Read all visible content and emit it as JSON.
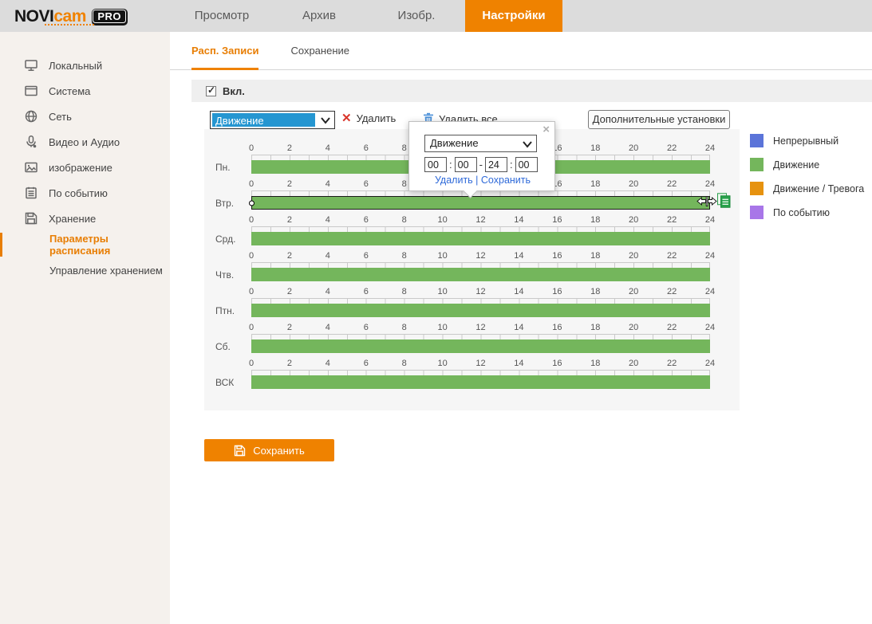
{
  "accent_color": "#ef8200",
  "brand": {
    "novi": "NOVI",
    "cam": "cam",
    "pro": "PRO"
  },
  "topnav": {
    "items": [
      {
        "label": "Просмотр",
        "active": false
      },
      {
        "label": "Архив",
        "active": false
      },
      {
        "label": "Изобр.",
        "active": false
      },
      {
        "label": "Настройки",
        "active": true
      }
    ]
  },
  "sidebar": {
    "items": [
      {
        "label": "Локальный",
        "icon": "monitor-icon"
      },
      {
        "label": "Система",
        "icon": "system-window-icon"
      },
      {
        "label": "Сеть",
        "icon": "network-globe-icon"
      },
      {
        "label": "Видео и Аудио",
        "icon": "microphone-icon"
      },
      {
        "label": "изображение",
        "icon": "image-icon"
      },
      {
        "label": "По событию",
        "icon": "event-list-icon"
      },
      {
        "label": "Хранение",
        "icon": "storage-floppy-icon"
      }
    ],
    "subitems": [
      {
        "label": "Параметры расписания",
        "active": true
      },
      {
        "label": "Управление хранением",
        "active": false
      }
    ]
  },
  "content_tabs": [
    {
      "label": "Расп. Записи",
      "active": true
    },
    {
      "label": "Сохранение",
      "active": false
    }
  ],
  "enable": {
    "label": "Вкл.",
    "checked": true,
    "check_glyph": "✓"
  },
  "toolbar": {
    "type_select_value": "Движение",
    "delete_label": "Удалить",
    "delete_icon_glyph": "✕",
    "delete_all_label": "Удалить все",
    "advanced_label": "Дополнительные установки"
  },
  "popup": {
    "close_label": "×",
    "type_select_value": "Движение",
    "start_hour": "00",
    "start_min": "00",
    "end_hour": "24",
    "end_min": "00",
    "colon": ":",
    "dash": "-",
    "delete_label": "Удалить",
    "separator": " | ",
    "save_label": "Сохранить"
  },
  "schedule": {
    "hours": [
      "0",
      "2",
      "4",
      "6",
      "8",
      "10",
      "12",
      "14",
      "16",
      "18",
      "20",
      "22",
      "24"
    ],
    "bar_color": "#74b65c",
    "days": [
      {
        "label": "Пн.",
        "selected": false,
        "interval": {
          "start": "00:00",
          "end": "24:00",
          "type": "Движение"
        }
      },
      {
        "label": "Втр.",
        "selected": true,
        "interval": {
          "start": "00:00",
          "end": "24:00",
          "type": "Движение"
        }
      },
      {
        "label": "Срд.",
        "selected": false,
        "interval": {
          "start": "00:00",
          "end": "24:00",
          "type": "Движение"
        }
      },
      {
        "label": "Чтв.",
        "selected": false,
        "interval": {
          "start": "00:00",
          "end": "24:00",
          "type": "Движение"
        }
      },
      {
        "label": "Птн.",
        "selected": false,
        "interval": {
          "start": "00:00",
          "end": "24:00",
          "type": "Движение"
        }
      },
      {
        "label": "Сб.",
        "selected": false,
        "interval": {
          "start": "00:00",
          "end": "24:00",
          "type": "Движение"
        }
      },
      {
        "label": "ВСК",
        "selected": false,
        "interval": {
          "start": "00:00",
          "end": "24:00",
          "type": "Движение"
        }
      }
    ]
  },
  "legend": [
    {
      "label": "Непрерывный",
      "color": "#5b74d9"
    },
    {
      "label": "Движение",
      "color": "#74b65c"
    },
    {
      "label": "Движение / Тревога",
      "color": "#e6920f"
    },
    {
      "label": "По событию",
      "color": "#a876e8"
    }
  ],
  "save_button": {
    "label": "Сохранить"
  }
}
